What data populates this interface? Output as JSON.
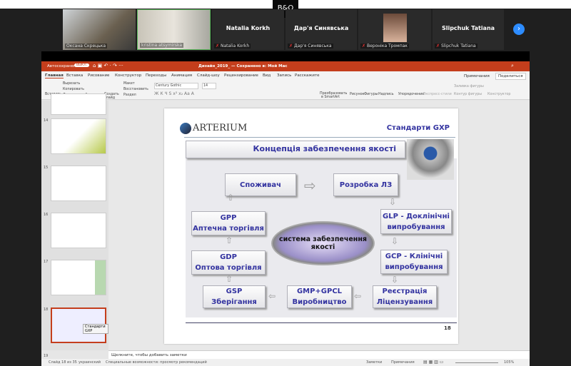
{
  "call": {
    "logo": "B&O",
    "participants": [
      {
        "label": "Оксана Скрецька",
        "video": true
      },
      {
        "label": "kristina atsymirska",
        "video": true
      },
      {
        "name": "Natalia Korkh",
        "label": "Natalia Korkh"
      },
      {
        "name": "Дар'я Синявська",
        "label": "Дар'я Синявська"
      },
      {
        "label": "Вероніка Тромпак",
        "photo": true
      },
      {
        "name": "Slipchuk Tatiana",
        "label": "Slipchuk Tatiana"
      }
    ],
    "next_icon": "chevron-right-icon",
    "accent": "#2d8cff"
  },
  "ppt": {
    "autosave": "Автосохранение",
    "autosave_state": "ВЫКЛ.",
    "doc_title": "Дизайн_2019_ — Сохранено в: Мой Mac",
    "tabs": [
      "Главная",
      "Вставка",
      "Рисование",
      "Конструктор",
      "Переходы",
      "Анимация",
      "Слайд-шоу",
      "Рецензирование",
      "Вид",
      "Запись",
      "Расскажите"
    ],
    "comments": "Примечания",
    "share": "Поделиться",
    "ribbon": {
      "paste": "Вставить",
      "cut": "Вырезать",
      "copy": "Копировать",
      "format": "Формат по образцу",
      "new_slide": "Создать слайд",
      "layout": "Макет",
      "reset": "Восстановить",
      "section": "Раздел",
      "font": "Century Gothic",
      "size": "14",
      "smartart": "Преобразовать в SmartArt",
      "picture": "Рисунок",
      "shapes": "Фигуры",
      "textbox": "Надпись",
      "arrange": "Упорядочение",
      "styles": "Экспресс-стили",
      "fill": "Заливка фигуры",
      "outline": "Контур фигуры",
      "designer": "Конструктор"
    },
    "thumbs": [
      "14",
      "15",
      "16",
      "17",
      "18",
      "19"
    ],
    "tooltip": "Стандарти GXP",
    "notes": "Щелкните, чтобы добавить заметки",
    "status": {
      "slide": "Слайд 18 из 35",
      "lang": "украинский",
      "access": "Специальные возможности: просмотр рекомендаций",
      "notes": "Заметки",
      "comments": "Примечания",
      "zoom": "105%"
    },
    "accent": "#c43e1c"
  },
  "slide": {
    "logo": "ARTERIUM",
    "header": "Стандарти GXP",
    "title": "Концепція забезпечення якості",
    "boxes": {
      "consumer": "Споживач",
      "dev": "Розробка ЛЗ",
      "gpp1": "GPP",
      "gpp2": "Аптечна торгівля",
      "glp1": "GLP - Доклінічні",
      "glp2": "випробування",
      "center1": "система забезпечення",
      "center2": "якості",
      "gdp1": "GDP",
      "gdp2": "Оптова торгівля",
      "gcp1": "GCP - Клінічні",
      "gcp2": "випробування",
      "gsp1": "GSP",
      "gsp2": "Зберігання",
      "gmp1": "GMP+GPCL",
      "gmp2": "Виробництво",
      "reg1": "Реєстрація",
      "reg2": "Ліцензування"
    },
    "page": "18",
    "text_color": "#3333a0"
  }
}
